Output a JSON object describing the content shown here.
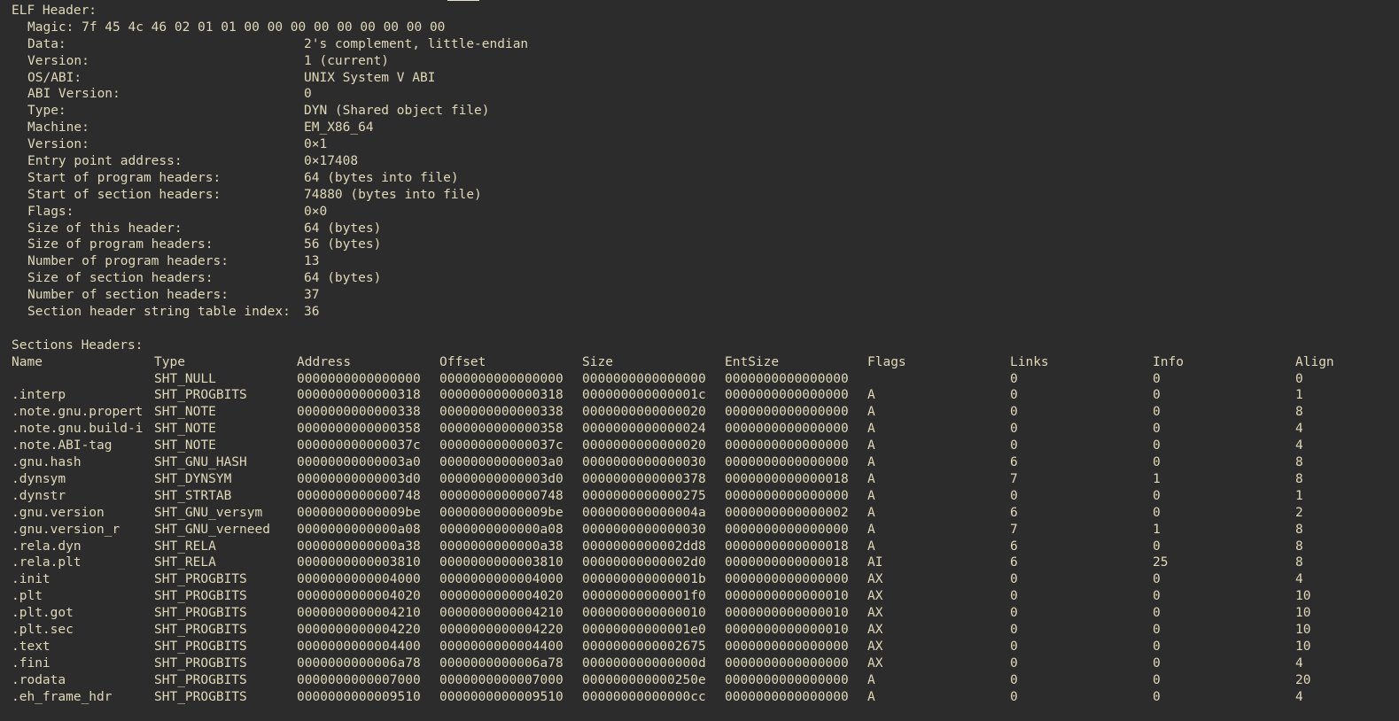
{
  "colors": {
    "background": "#2c2c2c",
    "text": "#e0d9b8",
    "prompt_text": "#6f8fa8",
    "cursor": "#e6e2cf"
  },
  "elf_header": {
    "title": "ELF Header:",
    "magic": "Magic: 7f 45 4c 46 02 01 01 00 00 00 00 00 00 00 00 00",
    "fields": [
      {
        "key": "Data:",
        "value": "2's complement, little-endian"
      },
      {
        "key": "Version:",
        "value": "1 (current)"
      },
      {
        "key": "OS/ABI:",
        "value": "UNIX System V ABI"
      },
      {
        "key": "ABI Version:",
        "value": "0"
      },
      {
        "key": "Type:",
        "value": "DYN (Shared object file)"
      },
      {
        "key": "Machine:",
        "value": "EM_X86_64"
      },
      {
        "key": "Version:",
        "value": "0×1"
      },
      {
        "key": "Entry point address:",
        "value": "0×17408"
      },
      {
        "key": "Start of program headers:",
        "value": "64 (bytes into file)"
      },
      {
        "key": "Start of section headers:",
        "value": "74880 (bytes into file)"
      },
      {
        "key": "Flags:",
        "value": "0×0"
      },
      {
        "key": "Size of this header:",
        "value": "64 (bytes)"
      },
      {
        "key": "Size of program headers:",
        "value": "56 (bytes)"
      },
      {
        "key": "Number of program headers:",
        "value": "13"
      },
      {
        "key": "Size of section headers:",
        "value": "64 (bytes)"
      },
      {
        "key": "Number of section headers:",
        "value": "37"
      },
      {
        "key": "Section header string table index:",
        "value": "36"
      }
    ]
  },
  "sections": {
    "title": "Sections Headers:",
    "columns": [
      "Name",
      "Type",
      "Address",
      "Offset",
      "Size",
      "EntSize",
      "Flags",
      "Links",
      "Info",
      "Align"
    ],
    "rows": [
      [
        "",
        "SHT_NULL",
        "0000000000000000",
        "0000000000000000",
        "0000000000000000",
        "0000000000000000",
        "",
        "0",
        "0",
        "0"
      ],
      [
        ".interp",
        "SHT_PROGBITS",
        "0000000000000318",
        "0000000000000318",
        "000000000000001c",
        "0000000000000000",
        "A",
        "0",
        "0",
        "1"
      ],
      [
        ".note.gnu.propert",
        "SHT_NOTE",
        "0000000000000338",
        "0000000000000338",
        "0000000000000020",
        "0000000000000000",
        "A",
        "0",
        "0",
        "8"
      ],
      [
        ".note.gnu.build-i",
        "SHT_NOTE",
        "0000000000000358",
        "0000000000000358",
        "0000000000000024",
        "0000000000000000",
        "A",
        "0",
        "0",
        "4"
      ],
      [
        ".note.ABI-tag",
        "SHT_NOTE",
        "000000000000037c",
        "000000000000037c",
        "0000000000000020",
        "0000000000000000",
        "A",
        "0",
        "0",
        "4"
      ],
      [
        ".gnu.hash",
        "SHT_GNU_HASH",
        "00000000000003a0",
        "00000000000003a0",
        "0000000000000030",
        "0000000000000000",
        "A",
        "6",
        "0",
        "8"
      ],
      [
        ".dynsym",
        "SHT_DYNSYM",
        "00000000000003d0",
        "00000000000003d0",
        "0000000000000378",
        "0000000000000018",
        "A",
        "7",
        "1",
        "8"
      ],
      [
        ".dynstr",
        "SHT_STRTAB",
        "0000000000000748",
        "0000000000000748",
        "0000000000000275",
        "0000000000000000",
        "A",
        "0",
        "0",
        "1"
      ],
      [
        ".gnu.version",
        "SHT_GNU_versym",
        "00000000000009be",
        "00000000000009be",
        "000000000000004a",
        "0000000000000002",
        "A",
        "6",
        "0",
        "2"
      ],
      [
        ".gnu.version_r",
        "SHT_GNU_verneed",
        "0000000000000a08",
        "0000000000000a08",
        "0000000000000030",
        "0000000000000000",
        "A",
        "7",
        "1",
        "8"
      ],
      [
        ".rela.dyn",
        "SHT_RELA",
        "0000000000000a38",
        "0000000000000a38",
        "0000000000002dd8",
        "0000000000000018",
        "A",
        "6",
        "0",
        "8"
      ],
      [
        ".rela.plt",
        "SHT_RELA",
        "0000000000003810",
        "0000000000003810",
        "00000000000002d0",
        "0000000000000018",
        "AI",
        "6",
        "25",
        "8"
      ],
      [
        ".init",
        "SHT_PROGBITS",
        "0000000000004000",
        "0000000000004000",
        "000000000000001b",
        "0000000000000000",
        "AX",
        "0",
        "0",
        "4"
      ],
      [
        ".plt",
        "SHT_PROGBITS",
        "0000000000004020",
        "0000000000004020",
        "00000000000001f0",
        "0000000000000010",
        "AX",
        "0",
        "0",
        "10"
      ],
      [
        ".plt.got",
        "SHT_PROGBITS",
        "0000000000004210",
        "0000000000004210",
        "0000000000000010",
        "0000000000000010",
        "AX",
        "0",
        "0",
        "10"
      ],
      [
        ".plt.sec",
        "SHT_PROGBITS",
        "0000000000004220",
        "0000000000004220",
        "00000000000001e0",
        "0000000000000010",
        "AX",
        "0",
        "0",
        "10"
      ],
      [
        ".text",
        "SHT_PROGBITS",
        "0000000000004400",
        "0000000000004400",
        "0000000000002675",
        "0000000000000000",
        "AX",
        "0",
        "0",
        "10"
      ],
      [
        ".fini",
        "SHT_PROGBITS",
        "0000000000006a78",
        "0000000000006a78",
        "000000000000000d",
        "0000000000000000",
        "AX",
        "0",
        "0",
        "4"
      ],
      [
        ".rodata",
        "SHT_PROGBITS",
        "0000000000007000",
        "0000000000007000",
        "000000000000250e",
        "0000000000000000",
        "A",
        "0",
        "0",
        "20"
      ],
      [
        ".eh_frame_hdr",
        "SHT_PROGBITS",
        "0000000000009510",
        "0000000000009510",
        "00000000000000cc",
        "0000000000000000",
        "A",
        "0",
        "0",
        "4"
      ]
    ]
  }
}
